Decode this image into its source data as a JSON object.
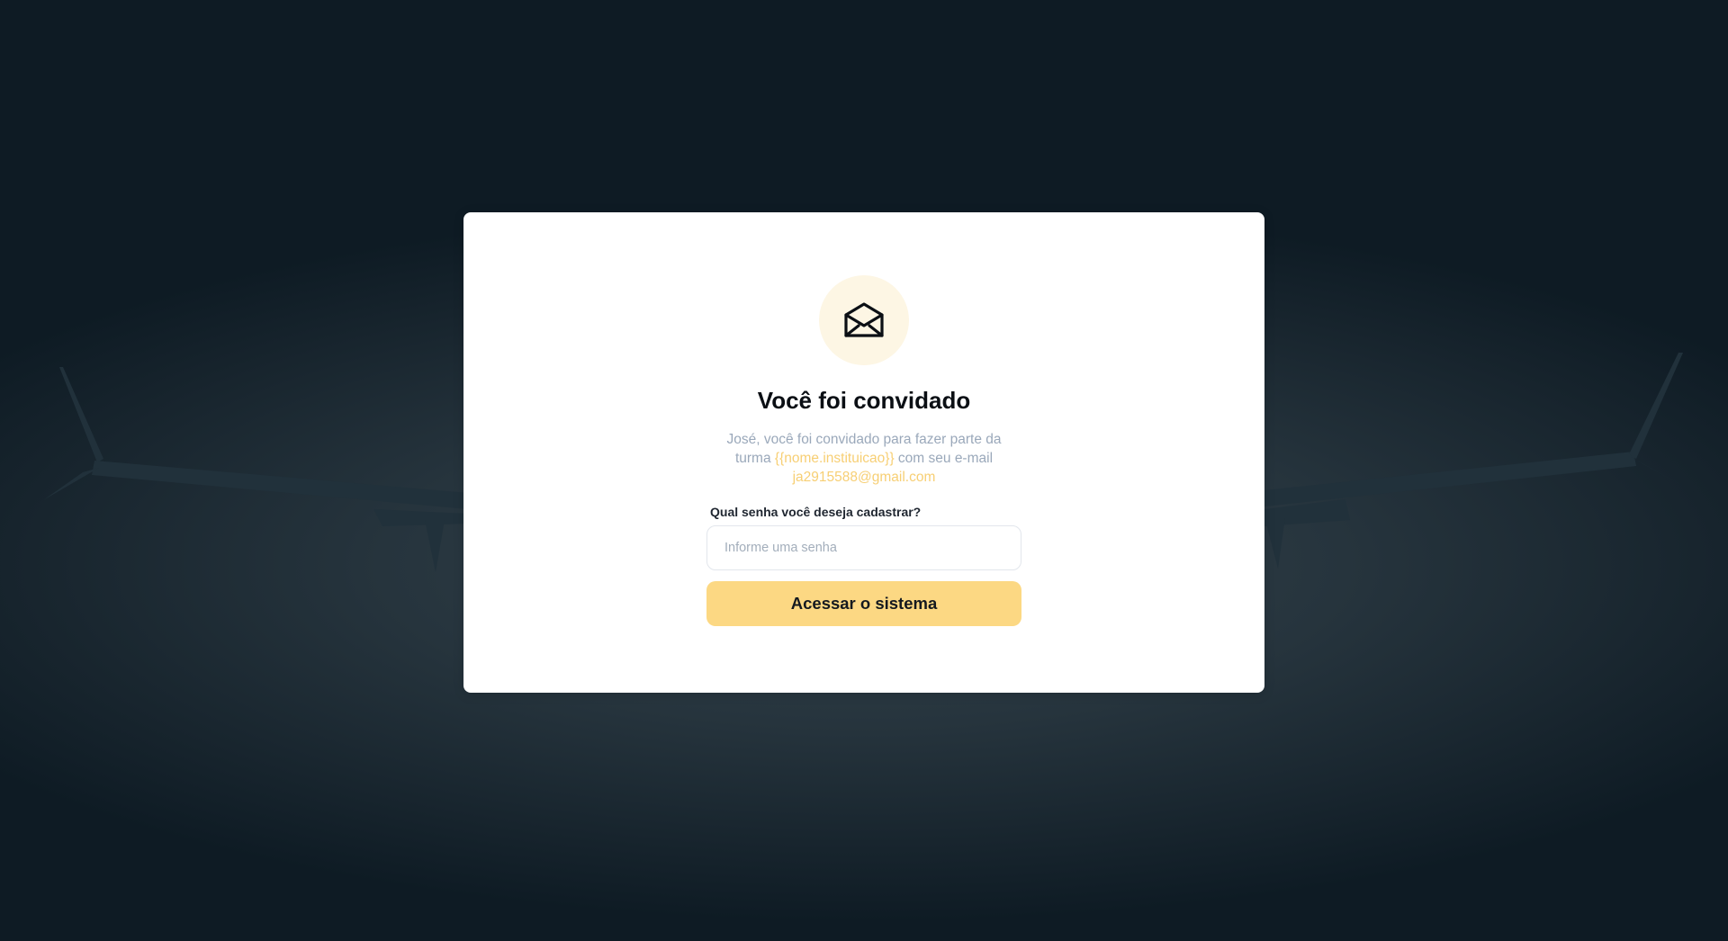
{
  "background": {
    "image": "airplane-wing-photo"
  },
  "invite": {
    "icon": "envelope-open-icon",
    "title": "Você foi convidado",
    "description": {
      "part1": "José, você foi convidado para fazer parte da turma ",
      "institution": "{{nome.instituicao}}",
      "part2": " com seu e-mail ",
      "email": "ja2915588@gmail.com"
    },
    "password_label": "Qual senha você deseja cadastrar?",
    "password_placeholder": "Informe uma senha",
    "password_value": "",
    "submit_label": "Acessar o sistema"
  },
  "colors": {
    "accent": "#fcd883",
    "highlight_text": "#f7cf74",
    "icon_bg": "#fdf6e4",
    "muted_text": "#9aa8ba",
    "background_dark": "#0e1b24"
  }
}
